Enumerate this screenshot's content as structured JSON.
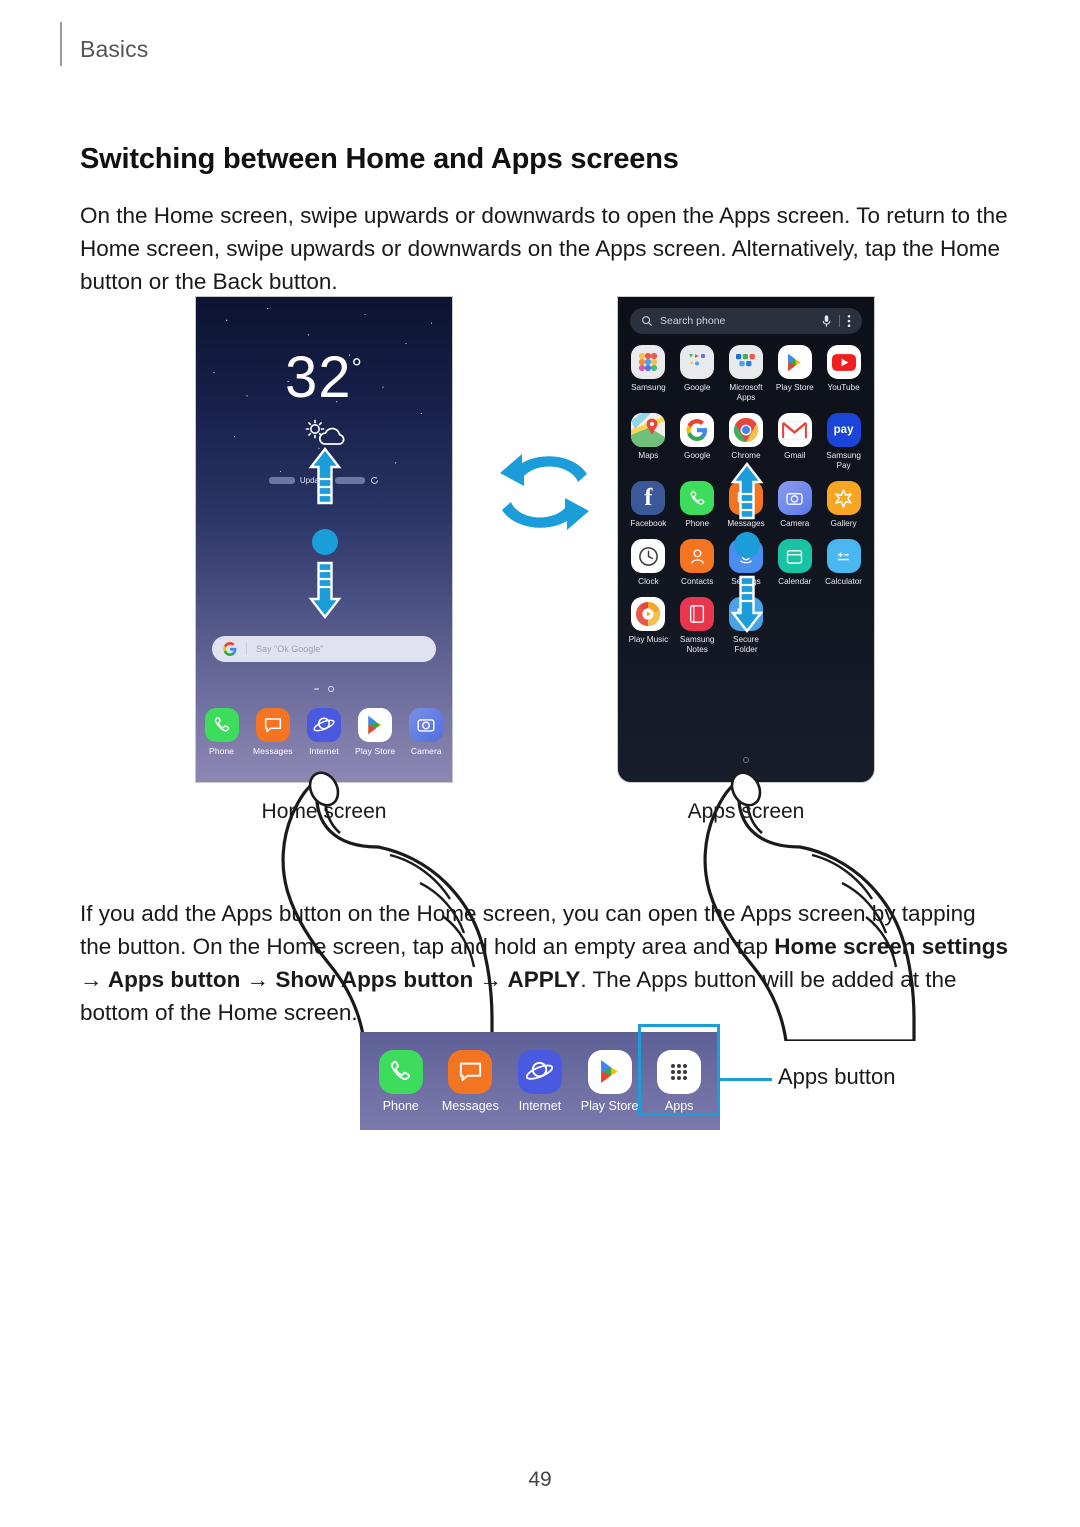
{
  "header": {
    "section_label": "Basics"
  },
  "title": "Switching between Home and Apps screens",
  "paragraph1": "On the Home screen, swipe upwards or downwards to open the Apps screen. To return to the Home screen, swipe upwards or downwards on the Apps screen. Alternatively, tap the Home button or the Back button.",
  "paragraph2": {
    "part1": "If you add the Apps button on the Home screen, you can open the Apps screen by tapping the button. On the Home screen, tap and hold an empty area and tap ",
    "bold1": "Home screen settings",
    "mid1": " → ",
    "bold2": "Apps button",
    "mid2": " → ",
    "bold3": "Show Apps button",
    "mid3": " → ",
    "bold4": "APPLY",
    "part2": ". The Apps button will be added at the bottom of the Home screen."
  },
  "figure": {
    "home_caption": "Home screen",
    "apps_caption": "Apps screen",
    "swap_icon": "swap-arrows-icon"
  },
  "home_screen": {
    "weather": {
      "temperature": "32",
      "degree_symbol": "°",
      "condition_icon": "partly-cloudy-icon",
      "updated_label": "Updated",
      "refresh_icon": "refresh-icon"
    },
    "google_search": {
      "logo": "google-g-icon",
      "placeholder": "Say \"Ok Google\""
    },
    "dock": [
      {
        "label": "Phone",
        "icon": "phone-icon",
        "color": "#3ddc5c"
      },
      {
        "label": "Messages",
        "icon": "messages-icon",
        "color": "#f47521"
      },
      {
        "label": "Internet",
        "icon": "internet-icon",
        "color": "#4a5ae0"
      },
      {
        "label": "Play Store",
        "icon": "play-store-icon",
        "color": "#ffffff"
      },
      {
        "label": "Camera",
        "icon": "camera-icon",
        "color": "#5b79e8"
      }
    ],
    "gesture": {
      "up_arrow": "swipe-up-arrow",
      "down_arrow": "swipe-down-arrow",
      "touch_point": "touch-indicator"
    }
  },
  "apps_screen": {
    "search": {
      "placeholder": "Search phone",
      "search_icon": "search-icon",
      "mic_icon": "microphone-icon",
      "more_icon": "more-options-icon"
    },
    "apps": [
      {
        "label": "Samsung",
        "icon": "samsung-folder-icon",
        "color": "#e9eaee"
      },
      {
        "label": "Google",
        "icon": "google-folder-icon",
        "color": "#e9eaee"
      },
      {
        "label": "Microsoft Apps",
        "icon": "microsoft-folder-icon",
        "color": "#e9eaee"
      },
      {
        "label": "Play Store",
        "icon": "play-store-icon",
        "color": "#ffffff"
      },
      {
        "label": "YouTube",
        "icon": "youtube-icon",
        "color": "#ffffff"
      },
      {
        "label": "Maps",
        "icon": "maps-icon",
        "color": "#ffffff"
      },
      {
        "label": "Google",
        "icon": "google-g-icon",
        "color": "#ffffff"
      },
      {
        "label": "Chrome",
        "icon": "chrome-icon",
        "color": "#ffffff"
      },
      {
        "label": "Gmail",
        "icon": "gmail-icon",
        "color": "#ffffff"
      },
      {
        "label": "Samsung Pay",
        "icon": "samsung-pay-icon",
        "color": "#1b44d8"
      },
      {
        "label": "Facebook",
        "icon": "facebook-icon",
        "color": "#3b5998"
      },
      {
        "label": "Phone",
        "icon": "phone-icon",
        "color": "#3ddc5c"
      },
      {
        "label": "Messages",
        "icon": "messages-icon",
        "color": "#f47521"
      },
      {
        "label": "Camera",
        "icon": "camera-icon",
        "color": "#7b8fe8"
      },
      {
        "label": "Gallery",
        "icon": "gallery-icon",
        "color": "#f6a623"
      },
      {
        "label": "Clock",
        "icon": "clock-icon",
        "color": "#ffffff"
      },
      {
        "label": "Contacts",
        "icon": "contacts-icon",
        "color": "#f47521"
      },
      {
        "label": "Settings",
        "icon": "settings-icon",
        "color": "#4a8ef0"
      },
      {
        "label": "Calendar",
        "icon": "calendar-icon",
        "color": "#17c3a2"
      },
      {
        "label": "Calculator",
        "icon": "calculator-icon",
        "color": "#4ab7f0"
      },
      {
        "label": "Play Music",
        "icon": "play-music-icon",
        "color": "#ffffff"
      },
      {
        "label": "Samsung Notes",
        "icon": "samsung-notes-icon",
        "color": "#e8364f"
      },
      {
        "label": "Secure Folder",
        "icon": "secure-folder-icon",
        "color": "#4aa3e8"
      }
    ],
    "gesture": {
      "up_arrow": "swipe-up-arrow",
      "down_arrow": "swipe-down-arrow",
      "touch_point": "touch-indicator"
    },
    "home_indicator": "page-indicator-dot"
  },
  "dock_figure": {
    "apps": [
      {
        "label": "Phone",
        "icon": "phone-icon",
        "color": "#3ddc5c"
      },
      {
        "label": "Messages",
        "icon": "messages-icon",
        "color": "#f47521"
      },
      {
        "label": "Internet",
        "icon": "internet-icon",
        "color": "#4a5ae0"
      },
      {
        "label": "Play Store",
        "icon": "play-store-icon",
        "color": "#ffffff"
      },
      {
        "label": "Apps",
        "icon": "apps-grid-icon",
        "color": "#ffffff"
      }
    ],
    "callout_label": "Apps button"
  },
  "footer": {
    "page_number": "49"
  },
  "colors": {
    "accent_blue": "#1b9dd9",
    "highlight_blue": "#1b9dd9",
    "home_bg_top": "#0d1430",
    "apps_bg": "#11151f",
    "dock_purple": "#6f6fa4"
  }
}
